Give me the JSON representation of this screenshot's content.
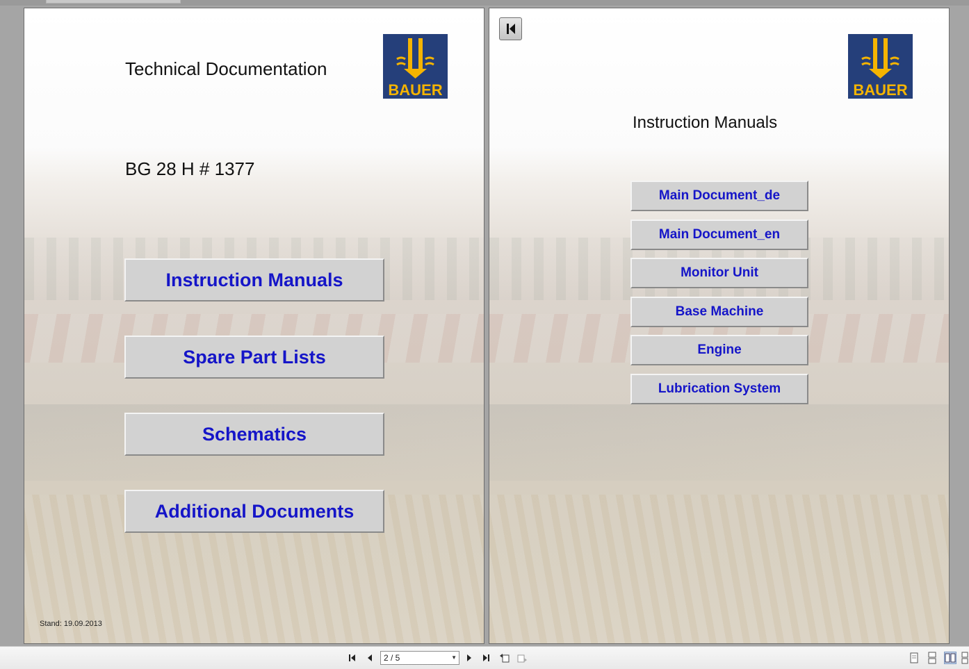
{
  "viewer": {
    "page_indicator": "2 / 5"
  },
  "left_page": {
    "title": "Technical Documentation",
    "machine_id": "BG 28 H # 1377",
    "logo_text": "BAUER",
    "buttons": [
      {
        "label": "Instruction Manuals"
      },
      {
        "label": "Spare Part Lists"
      },
      {
        "label": "Schematics"
      },
      {
        "label": "Additional Documents"
      }
    ],
    "stand_text": "Stand: 19.09.2013"
  },
  "right_page": {
    "title": "Instruction Manuals",
    "logo_text": "BAUER",
    "buttons": [
      {
        "label": "Main Document_de"
      },
      {
        "label": "Main Document_en"
      },
      {
        "label": "Monitor Unit"
      },
      {
        "label": "Base Machine"
      },
      {
        "label": "Engine"
      },
      {
        "label": "Lubrication System"
      }
    ]
  },
  "colors": {
    "button_text": "#1515c8",
    "button_face": "#d2d2d2",
    "logo_blue": "#253f7a",
    "logo_yellow": "#f5b400"
  },
  "icons": [
    "back-to-first-icon",
    "first-page-icon",
    "previous-page-icon",
    "next-page-icon",
    "last-page-icon",
    "previous-view-icon",
    "next-view-icon",
    "single-page-icon",
    "continuous-page-icon",
    "two-page-icon",
    "two-page-continuous-icon"
  ]
}
